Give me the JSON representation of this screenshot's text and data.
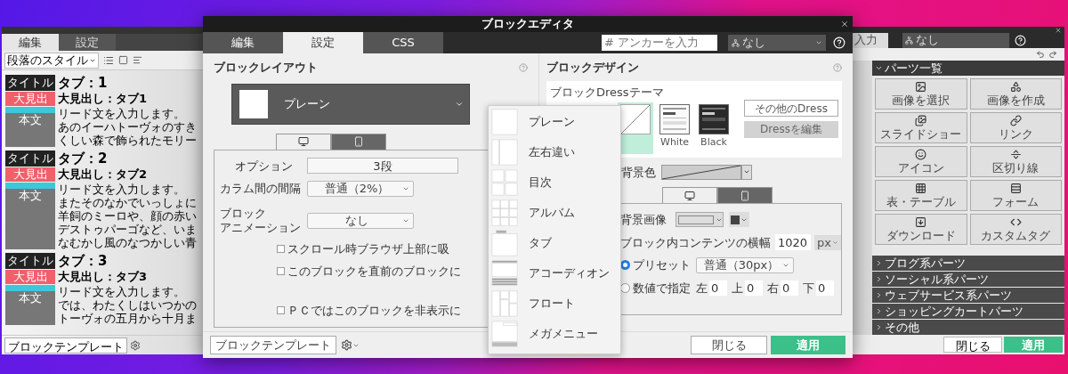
{
  "back_window": {
    "left_pane": {
      "tabs": [
        {
          "label": "編集",
          "selected": true
        },
        {
          "label": "設定",
          "selected": false
        }
      ],
      "style_select": "段落のスタイル",
      "blocks": [
        {
          "title_badge": "タイトル",
          "heading_badge": "大見出",
          "body_badge": "本文",
          "title": "タブ：1",
          "heading": "大見出し：タブ1",
          "lines": [
            "リード文を入力します。",
            "あのイーハトーヴォのすき",
            "くしい森で飾られたモリー"
          ]
        },
        {
          "title_badge": "タイトル",
          "heading_badge": "大見出",
          "body_badge": "本文",
          "title": "タブ：2",
          "heading": "大見出し：タブ2",
          "lines": [
            "リード文を入力します。",
            "またそのなかでいっしょに",
            "羊飼のミーロや、顔の赤い",
            "デストゥパーゴなど、いま",
            "なむかし風のなつかしい青"
          ]
        },
        {
          "title_badge": "タイトル",
          "heading_badge": "大見出",
          "body_badge": "本文",
          "title": "タブ：3",
          "heading": "大見出し：タブ3",
          "lines": [
            "リード文を入力します。",
            "では、わたくしはいつかの",
            "トーヴォの五月から十月ま"
          ]
        }
      ],
      "template_button": "ブロックテンプレート"
    },
    "right_pane": {
      "anchor_field": "入力",
      "select": "なし",
      "parts_header": "パーツ一覧",
      "parts": [
        "画像を選択",
        "画像を作成",
        "スライドショー",
        "リンク",
        "アイコン",
        "区切り線",
        "表・テーブル",
        "フォーム",
        "ダウンロード",
        "カスタムタグ"
      ],
      "sections": [
        {
          "label": "ブログ系パーツ",
          "expanded": false
        },
        {
          "label": "ソーシャル系パーツ",
          "expanded": false
        },
        {
          "label": "ウェブサービス系パーツ",
          "expanded": false
        },
        {
          "label": "ショッピングカートパーツ",
          "expanded": false
        },
        {
          "label": "その他",
          "expanded": false
        }
      ],
      "close_button": "閉じる",
      "apply_button": "適用"
    }
  },
  "editor": {
    "title": "ブロックエディタ",
    "tabs": [
      {
        "label": "編集",
        "selected": false
      },
      {
        "label": "設定",
        "selected": true
      },
      {
        "label": "CSS",
        "selected": false
      }
    ],
    "anchor_field": {
      "placeholder": "# アンカーを入力"
    },
    "anchor_select": "なし",
    "layout": {
      "header": "ブロックレイアウト",
      "selected_layout": "プレーン",
      "device_tabs": [
        {
          "kind": "desktop",
          "selected": true
        },
        {
          "kind": "mobile",
          "selected": false
        }
      ],
      "option_label": "オプション",
      "option_value": "3段",
      "gap_label": "カラム間の間隔",
      "gap_value": "普通（2%）",
      "animation_label_lines": [
        "ブロック",
        "アニメーション"
      ],
      "animation_value": "なし",
      "checkboxes": [
        {
          "label": "スクロール時ブラウザ上部に吸",
          "checked": false
        },
        {
          "label": "このブロックを直前のブロックに",
          "checked": false
        },
        {
          "label": "ＰＣではこのブロックを非表示に",
          "checked": false
        }
      ]
    },
    "design": {
      "header": "ブロックデザイン",
      "theme_label": "ブロックDressテーマ",
      "themes": [
        {
          "kind": "none",
          "selected": true
        },
        {
          "kind": "white",
          "label": "White",
          "selected": false
        },
        {
          "kind": "black",
          "label": "Black",
          "selected": false
        }
      ],
      "other_dress_button": "その他のDress",
      "edit_dress_button": {
        "label": "Dressを編集",
        "disabled": true
      },
      "bg_color_label": "背景色",
      "device_tabs": [
        {
          "kind": "desktop",
          "selected": true
        },
        {
          "kind": "mobile",
          "selected": false
        }
      ],
      "bg_image_label": "背景画像",
      "width_label": "ブロック内コンテンツの横幅",
      "width_value": "1020",
      "width_unit": "px",
      "radios": [
        {
          "label": "プリセット",
          "selected": true
        },
        {
          "label": "数値で指定",
          "selected": false
        }
      ],
      "preset_value": "普通（30px）",
      "margins": [
        {
          "label": "左",
          "value": "0"
        },
        {
          "label": "上",
          "value": "0"
        },
        {
          "label": "右",
          "value": "0"
        },
        {
          "label": "下",
          "value": "0"
        }
      ]
    },
    "template_button": "ブロックテンプレート",
    "close_button": "閉じる",
    "apply_button": "適用"
  },
  "layout_menu": [
    {
      "kind": "plain",
      "label": "プレーン"
    },
    {
      "kind": "split",
      "label": "左右違い"
    },
    {
      "kind": "toc",
      "label": "目次"
    },
    {
      "kind": "album",
      "label": "アルバム"
    },
    {
      "kind": "tab",
      "label": "タブ"
    },
    {
      "kind": "accordion",
      "label": "アコーディオン"
    },
    {
      "kind": "float",
      "label": "フロート"
    },
    {
      "kind": "megamenu",
      "label": "メガメニュー"
    }
  ]
}
